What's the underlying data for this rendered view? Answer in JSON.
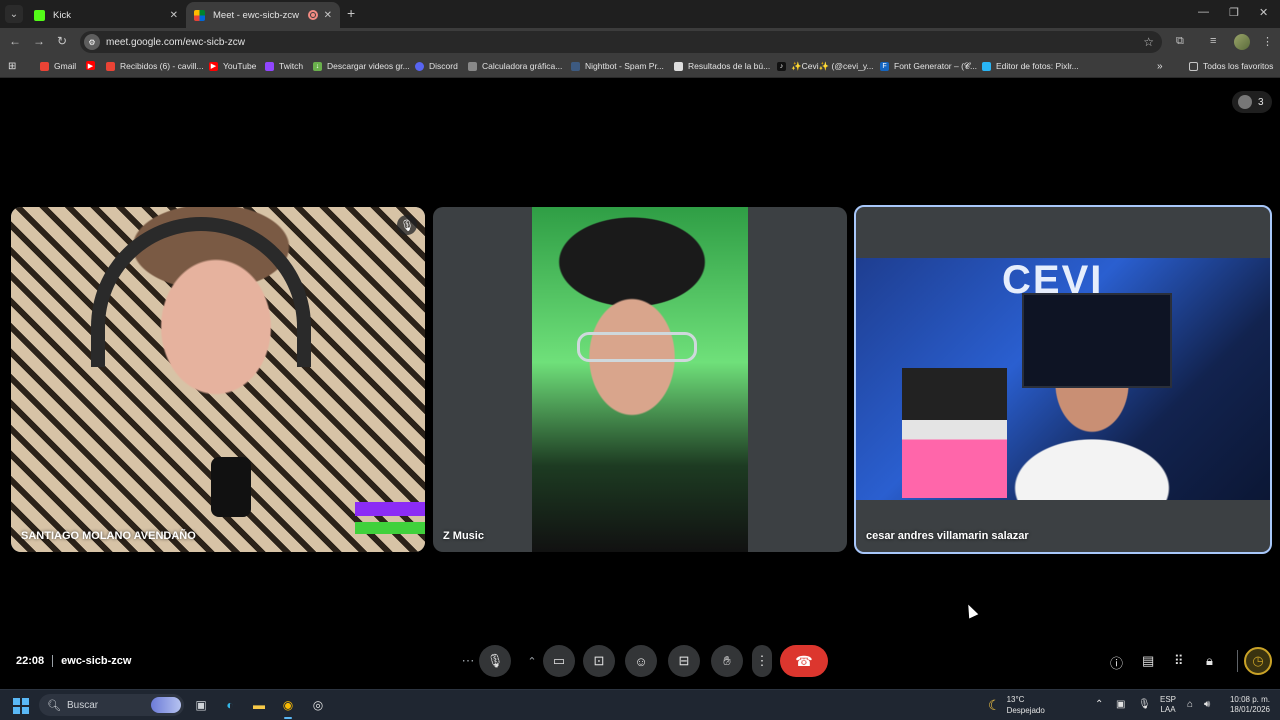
{
  "browser": {
    "tabs": [
      {
        "title": "Kick"
      },
      {
        "title": "Meet - ewc-sicb-zcw"
      }
    ],
    "url": "meet.google.com/ewc-sicb-zcw",
    "bookmarks": [
      {
        "label": "Gmail",
        "color": "#ea4335"
      },
      {
        "label": "",
        "color": "#ff0000"
      },
      {
        "label": "Recibidos (6) - cavill...",
        "color": "#ea4335"
      },
      {
        "label": "YouTube",
        "color": "#ff0000"
      },
      {
        "label": "Twitch",
        "color": "#9146ff"
      },
      {
        "label": "Descargar videos gr...",
        "color": "#6ab04c"
      },
      {
        "label": "Discord",
        "color": "#5865f2"
      },
      {
        "label": "Calculadora gráfica...",
        "color": "#888888"
      },
      {
        "label": "Nightbot - Spam Pr...",
        "color": "#3d5a80"
      },
      {
        "label": "Resultados de la bú...",
        "color": "#dddddd"
      },
      {
        "label": "✨Cevi✨ (@cevi_y...",
        "color": "#111111"
      },
      {
        "label": "Font Generator – (𝓒...",
        "color": "#1565c0"
      },
      {
        "label": "Editor de fotos: Pixlr...",
        "color": "#29b6f6"
      }
    ],
    "all_bookmarks": "Todos los favoritos"
  },
  "meet": {
    "participant_count": "3",
    "participants": [
      {
        "name": "SANTIAGO MOLANO AVENDAÑO",
        "muted": true
      },
      {
        "name": "Z Music",
        "muted": false
      },
      {
        "name": "cesar andres villamarin salazar",
        "muted": false,
        "speaking": true
      }
    ],
    "video_overlay_text": "CEVI",
    "time": "22:08",
    "meeting_code": "ewc-sicb-zcw",
    "colors": {
      "hangup": "#dc362e",
      "active_border": "#a8c7fa",
      "control_bg": "#333537"
    }
  },
  "taskbar": {
    "search_placeholder": "Buscar",
    "weather_temp": "13°C",
    "weather_desc": "Despejado",
    "lang_line1": "ESP",
    "lang_line2": "LAA",
    "clock_time": "10:08 p. m.",
    "clock_date": "18/01/2026"
  }
}
